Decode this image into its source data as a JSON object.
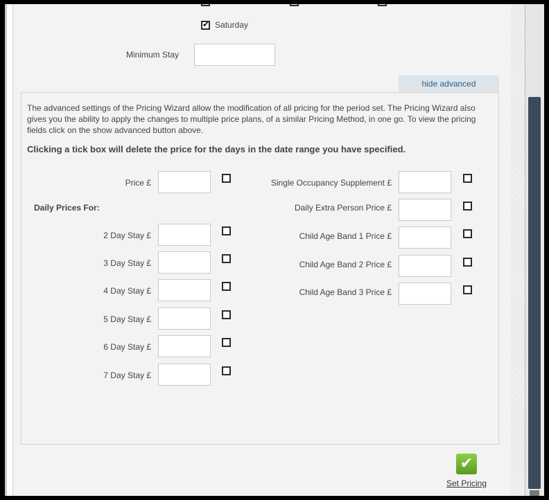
{
  "days": {
    "saturday": {
      "label": "Saturday",
      "checked": true
    }
  },
  "minimum_stay": {
    "label": "Minimum Stay",
    "value": ""
  },
  "advanced": {
    "toggle_label": "hide advanced",
    "description": "The advanced settings of the Pricing Wizard allow the modification of all pricing for the period set. The Pricing Wizard also gives you the ability to apply the changes to multiple price plans, of a similar Pricing Method, in one go. To view the pricing fields click on the show advanced button above.",
    "warning": "Clicking a tick box will delete the price for the days in the date range you have specified.",
    "daily_prices_heading": "Daily Prices For:",
    "price_label": "Price £",
    "left_fields": [
      {
        "label": "2 Day Stay £",
        "value": "",
        "checked": false
      },
      {
        "label": "3 Day Stay £",
        "value": "",
        "checked": false
      },
      {
        "label": "4 Day Stay £",
        "value": "",
        "checked": false
      },
      {
        "label": "5 Day Stay £",
        "value": "",
        "checked": false
      },
      {
        "label": "6 Day Stay £",
        "value": "",
        "checked": false
      },
      {
        "label": "7 Day Stay £",
        "value": "",
        "checked": false
      }
    ],
    "right_fields": [
      {
        "label": "Single Occupancy Supplement £",
        "value": "",
        "checked": false
      },
      {
        "label": "Daily Extra Person Price £",
        "value": "",
        "checked": false
      },
      {
        "label": "Child Age Band 1 Price £",
        "value": "",
        "checked": false
      },
      {
        "label": "Child Age Band 2 Price £",
        "value": "",
        "checked": false
      },
      {
        "label": "Child Age Band 3 Price £",
        "value": "",
        "checked": false
      }
    ]
  },
  "actions": {
    "set_pricing_label": "Set Pricing",
    "set_pricing_icon": "checkmark-icon"
  },
  "colors": {
    "accent_link": "#2c5e86",
    "tab_bg": "#dde4ea",
    "scroll_thumb": "#3c4b5c",
    "panel_bg": "#f3f3f3",
    "icon_green": "#6fb22e"
  }
}
